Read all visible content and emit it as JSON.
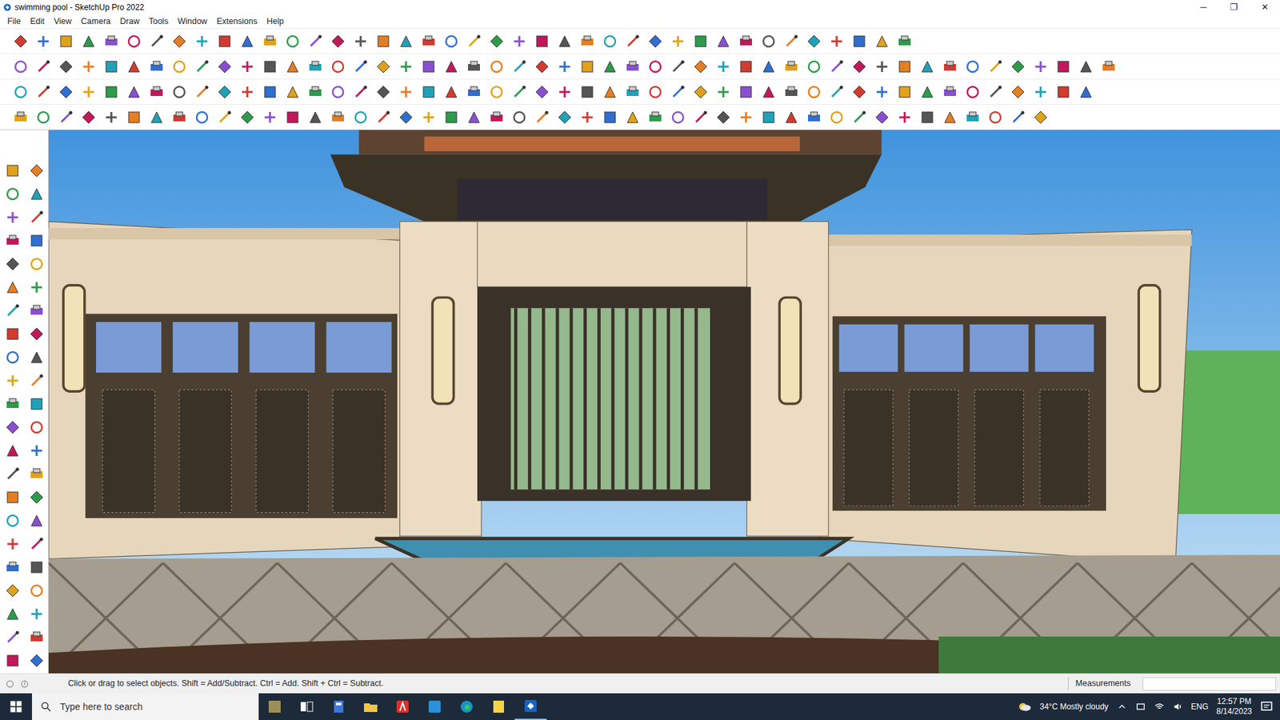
{
  "window": {
    "title": "swimming pool - SketchUp Pro 2022",
    "controls": [
      "─",
      "❐",
      "✕"
    ]
  },
  "menu": [
    "File",
    "Edit",
    "View",
    "Camera",
    "Draw",
    "Tools",
    "Window",
    "Extensions",
    "Help"
  ],
  "status_bar": {
    "hint": "Click or drag to select objects. Shift = Add/Subtract. Ctrl = Add. Shift + Ctrl = Subtract.",
    "measurements_label": "Measurements"
  },
  "taskbar": {
    "search_placeholder": "Type here to search",
    "weather": "34°C  Mostly cloudy",
    "language": "ENG",
    "time": "12:57 PM",
    "date": "8/14/2023"
  }
}
